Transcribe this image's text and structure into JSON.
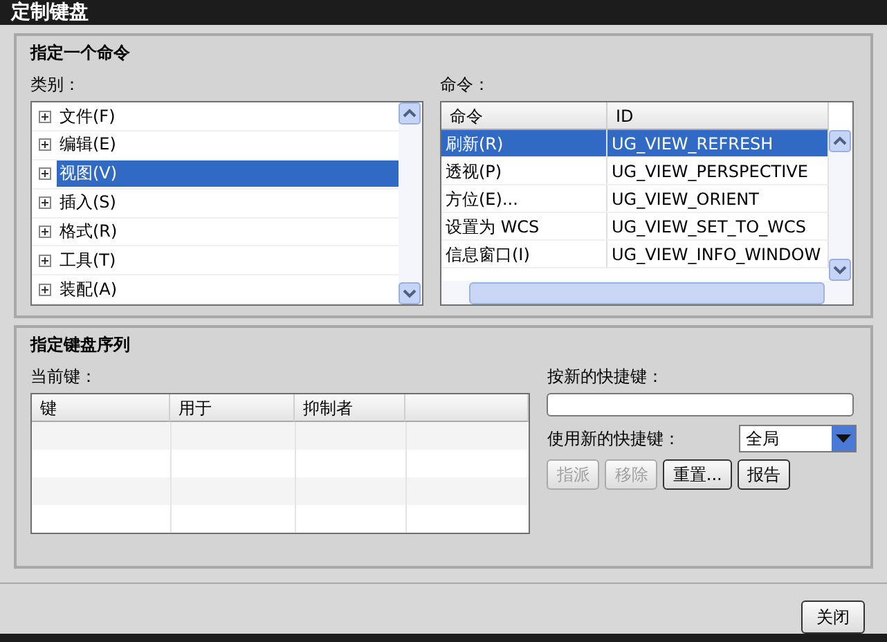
{
  "window": {
    "title": "定制键盘"
  },
  "command_group": {
    "title": "指定一个命令",
    "category_label": "类别：",
    "categories": [
      {
        "label": "文件(F)",
        "selected": false
      },
      {
        "label": "编辑(E)",
        "selected": false
      },
      {
        "label": "视图(V)",
        "selected": true
      },
      {
        "label": "插入(S)",
        "selected": false
      },
      {
        "label": "格式(R)",
        "selected": false
      },
      {
        "label": "工具(T)",
        "selected": false
      },
      {
        "label": "装配(A)",
        "selected": false
      }
    ],
    "commands_label": "命令：",
    "columns": [
      "命令",
      "ID"
    ],
    "commands": [
      {
        "name": "刷新(R)",
        "id": "UG_VIEW_REFRESH",
        "selected": true
      },
      {
        "name": "透视(P)",
        "id": "UG_VIEW_PERSPECTIVE",
        "selected": false
      },
      {
        "name": "方位(E)...",
        "id": "UG_VIEW_ORIENT",
        "selected": false
      },
      {
        "name": "设置为 WCS",
        "id": "UG_VIEW_SET_TO_WCS",
        "selected": false
      },
      {
        "name": "信息窗口(I)",
        "id": "UG_VIEW_INFO_WINDOW",
        "selected": false
      }
    ]
  },
  "sequence_group": {
    "title": "指定键盘序列",
    "current_keys_label": "当前键：",
    "columns": [
      "键",
      "用于",
      "抑制者"
    ],
    "new_key_label": "按新的快捷键：",
    "use_label": "使用新的快捷键：",
    "scope": "全局",
    "buttons": [
      {
        "label": "指派",
        "disabled": true
      },
      {
        "label": "移除",
        "disabled": true
      },
      {
        "label": "重置...",
        "disabled": false
      },
      {
        "label": "报告",
        "disabled": false
      }
    ]
  },
  "close_button": "关闭"
}
